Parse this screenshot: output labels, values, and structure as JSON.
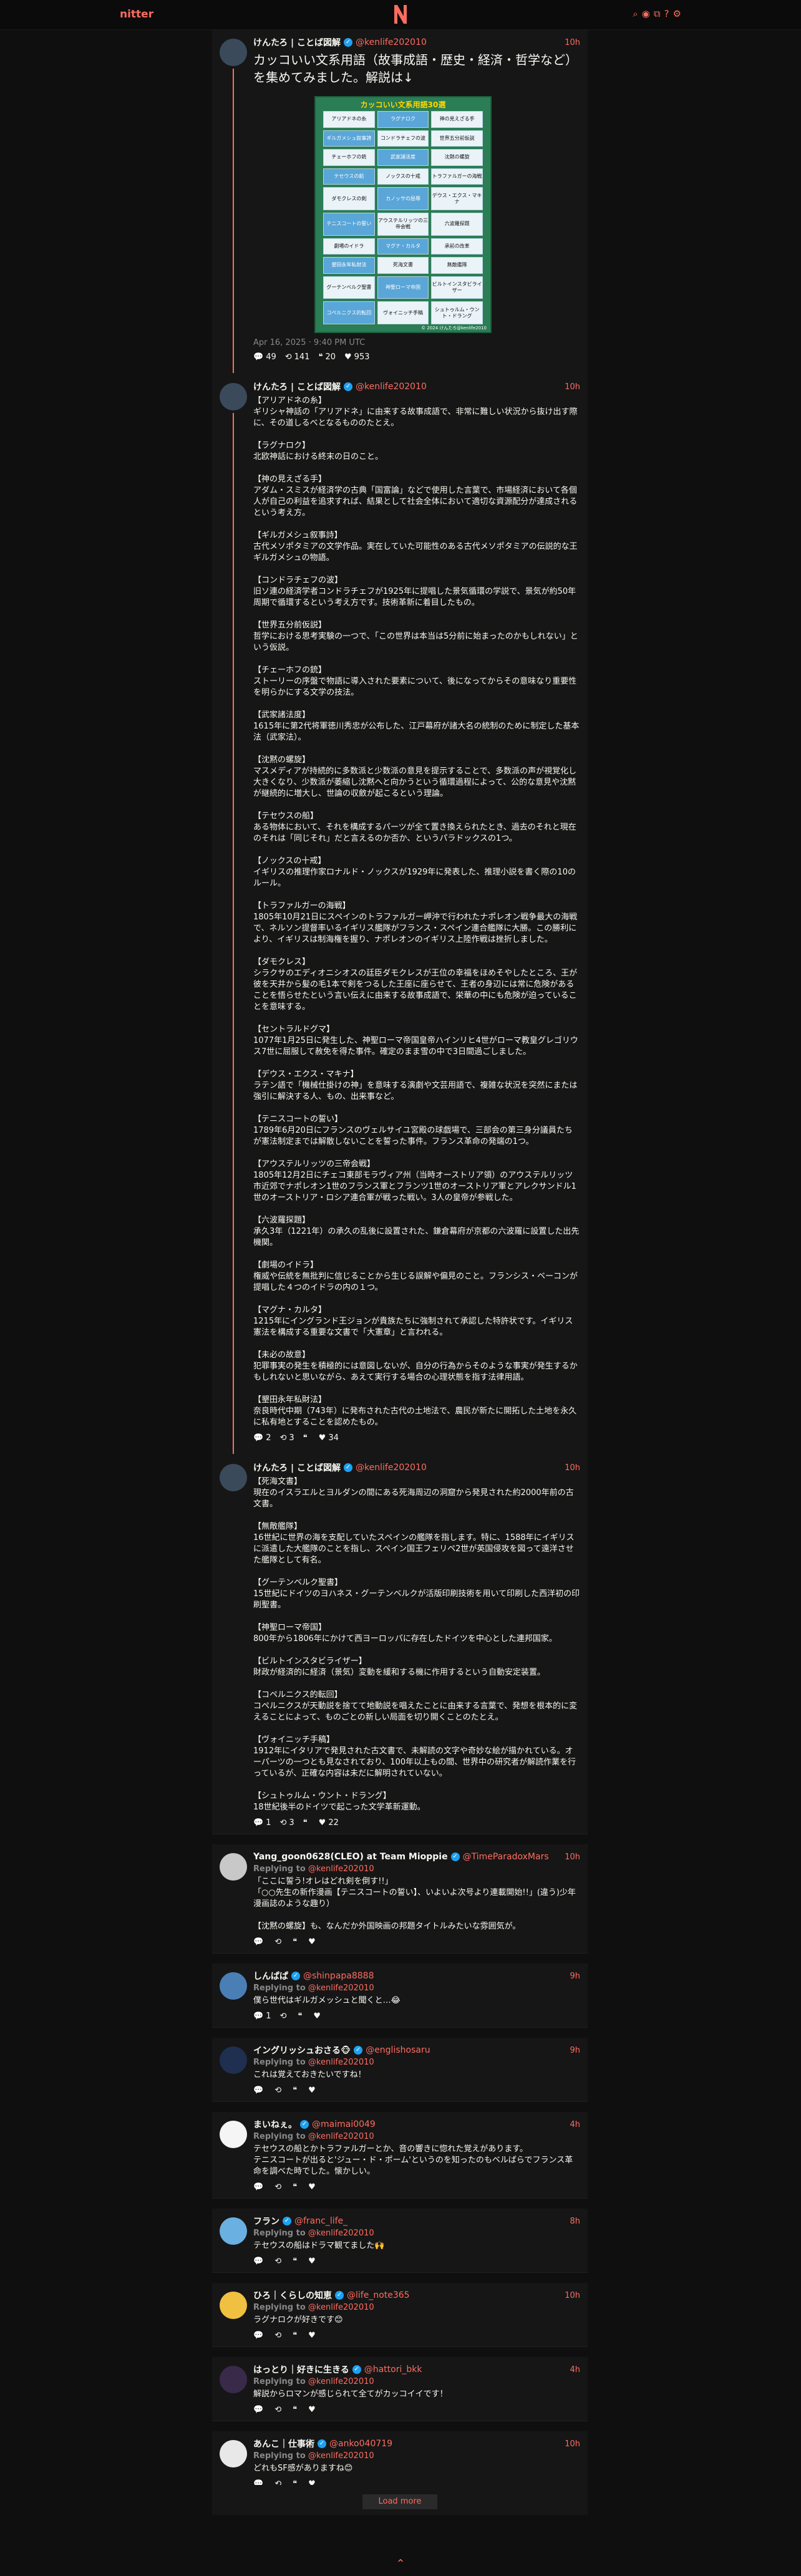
{
  "nav": {
    "brand": "nitter",
    "icons": [
      "search-icon",
      "rss-icon",
      "copy-icon",
      "info-icon",
      "settings-icon"
    ]
  },
  "main_tweet": {
    "fullname": "けんたろ | ことば図解",
    "username": "@kenlife202010",
    "date": "10h",
    "text": "カッコいい文系用語（故事成語・歴史・経済・哲学など）を集めてみました。解説は↓",
    "image": {
      "title": "カッコいい文系用語30選",
      "cells": [
        "アリアドネの糸",
        "ラグナロク",
        "神の見えざる手",
        "ギルガメシュ叙事詩",
        "コンドラチェフの波",
        "世界五分前仮説",
        "チェーホフの銃",
        "武家諸法度",
        "沈黙の螺旋",
        "テセウスの船",
        "ノックスの十戒",
        "トラファルガーの海戦",
        "ダモクレスの剣",
        "カノッサの屈辱",
        "デウス・エクス・マキナ",
        "テニスコートの誓い",
        "アウステルリッツの三帝会戦",
        "六波羅探題",
        "劇場のイドラ",
        "マグナ・カルタ",
        "承前の改革",
        "墾田永年私財法",
        "死海文書",
        "無敵艦隊",
        "グーテンベルク聖書",
        "神聖ローマ帝国",
        "ビルトインスタビライザー",
        "コペルニクス的転回",
        "ヴォイニッチ手稿",
        "シュトゥルム・ウント・ドラング"
      ],
      "credit": "© 2024 けんたろ@kenlife2010"
    },
    "timestamp": "Apr 16, 2025 · 9:40 PM UTC",
    "stats": {
      "replies": "49",
      "retweets": "141",
      "quotes": "20",
      "likes": "953"
    }
  },
  "thread_tweets": [
    {
      "fullname": "けんたろ | ことば図解",
      "username": "@kenlife202010",
      "date": "10h",
      "text": "【アリアドネの糸】\nギリシャ神話の「アリアドネ」に由来する故事成語で、非常に難しい状況から抜け出す際に、その道しるべとなるもののたとえ。\n\n【ラグナロク】\n北欧神話における終末の日のこと。\n\n【神の見えざる手】\nアダム・スミスが経済学の古典「国富論」などで使用した言葉で、市場経済において各個人が自己の利益を追求すれば、結果として社会全体において適切な資源配分が達成されるという考え方。\n\n【ギルガメシュ叙事詩】\n古代メソポタミアの文学作品。実在していた可能性のある古代メソポタミアの伝説的な王ギルガメシュの物語。\n\n【コンドラチェフの波】\n旧ソ連の経済学者コンドラチェフが1925年に提唱した景気循環の学説で、景気が約50年周期で循環するという考え方です。技術革新に着目したもの。\n\n【世界五分前仮説】\n哲学における思考実験の一つで、「この世界は本当は5分前に始まったのかもしれない」という仮説。\n\n【チェーホフの銃】\nストーリーの序盤で物語に導入された要素について、後になってからその意味なり重要性を明らかにする文学の技法。\n\n【武家諸法度】\n1615年に第2代将軍徳川秀忠が公布した、江戸幕府が諸大名の統制のために制定した基本法（武家法）。\n\n【沈黙の螺旋】\nマスメディアが持続的に多数派と少数派の意見を提示することで、多数派の声が視覚化し大きくなり、少数派が萎縮し沈黙へと向かうという循環過程によって、公的な意見や沈黙が継続的に増大し、世論の収斂が起こるという理論。\n\n【テセウスの船】\nある物体において、それを構成するパーツが全て置き換えられたとき、過去のそれと現在のそれは「同じそれ」だと言えるのか否か、というパラドックスの1つ。\n\n【ノックスの十戒】\nイギリスの推理作家ロナルド・ノックスが1929年に発表した、推理小説を書く際の10のルール。\n\n【トラファルガーの海戦】\n1805年10月21日にスペインのトラファルガー岬沖で行われたナポレオン戦争最大の海戦で、ネルソン提督率いるイギリス艦隊がフランス・スペイン連合艦隊に大勝。この勝利により、イギリスは制海権を握り、ナポレオンのイギリス上陸作戦は挫折しました。\n\n【ダモクレス】\nシラクサのエディオニシオスの廷臣ダモクレスが王位の幸福をほめそやしたところ、王が彼を天井から髪の毛1本で剣をつるした王座に座らせて、王者の身辺には常に危険があることを悟らせたという言い伝えに由来する故事成語で、栄華の中にも危険が迫っていることを意味する。\n\n【セントラルドグマ】\n1077年1月25日に発生した、神聖ローマ帝国皇帝ハインリヒ4世がローマ教皇グレゴリウス7世に屈服して赦免を得た事件。確定のまま雪の中で3日間過ごしました。\n\n【デウス・エクス・マキナ】\nラテン語で「機械仕掛けの神」を意味する演劇や文芸用語で、複雑な状況を突然にまたは強引に解決する人、もの、出来事など。\n\n【テニスコートの誓い】\n1789年6月20日にフランスのヴェルサイユ宮殿の球戯場で、三部会の第三身分議員たちが憲法制定までは解散しないことを誓った事件。フランス革命の発端の1つ。\n\n【アウステルリッツの三帝会戦】\n1805年12月2日にチェコ東部モラヴィア州（当時オーストリア領）のアウステルリッツ市近郊でナポレオン1世のフランス軍とフランツ1世のオーストリア軍とアレクサンドル1世のオーストリア・ロシア連合軍が戦った戦い。3人の皇帝が参戦した。\n\n【六波羅探題】\n承久3年（1221年）の承久の乱後に設置された、鎌倉幕府が京都の六波羅に設置した出先機関。\n\n【劇場のイドラ】\n権威や伝統を無批判に信じることから生じる誤解や偏見のこと。フランシス・ベーコンが提唱した４つのイドラの内の１つ。\n\n【マグナ・カルタ】\n1215年にイングランド王ジョンが貴族たちに強制されて承認した特許状です。イギリス憲法を構成する重要な文書で「大憲章」と言われる。\n\n【未必の故意】\n犯罪事実の発生を積極的には意図しないが、自分の行為からそのような事実が発生するかもしれないと思いながら、あえて実行する場合の心理状態を指す法律用語。\n\n【墾田永年私財法】\n奈良時代中期（743年）に発布された古代の土地法で、農民が新たに開拓した土地を永久に私有地とすることを認めたもの。",
      "stats": {
        "replies": "2",
        "retweets": "3",
        "quotes": "",
        "likes": "34"
      }
    },
    {
      "fullname": "けんたろ | ことば図解",
      "username": "@kenlife202010",
      "date": "10h",
      "text": "【死海文書】\n現在のイスラエルとヨルダンの間にある死海周辺の洞窟から発見された約2000年前の古文書。\n\n【無敵艦隊】\n16世紀に世界の海を支配していたスペインの艦隊を指します。特に、1588年にイギリスに派遣した大艦隊のことを指し、スペイン国王フェリペ2世が英国侵攻を図って遠洋させた艦隊として有名。\n\n【グーテンベルク聖書】\n15世紀にドイツのヨハネス・グーテンベルクが活版印刷技術を用いて印刷した西洋初の印刷聖書。\n\n【神聖ローマ帝国】\n800年から1806年にかけて西ヨーロッパに存在したドイツを中心とした連邦国家。\n\n【ビルトインスタビライザー】\n財政が経済的に経済（景気）変動を緩和する機に作用するという自動安定装置。\n\n【コペルニクス的転回】\nコペルニクスが天動説を捨てて地動説を唱えたことに由来する言葉で、発想を根本的に変えることによって、ものごとの新しい局面を切り開くことのたとえ。\n\n【ヴォイニッチ手稿】\n1912年にイタリアで発見された古文書で、未解読の文字や奇妙な絵が描かれている。オーパーツの一つとも見なされており、100年以上もの間、世界中の研究者が解読作業を行っているが、正確な内容は未だに解明されていない。\n\n【シュトゥルム・ウント・ドラング】\n18世紀後半のドイツで起こった文学革新運動。",
      "stats": {
        "replies": "1",
        "retweets": "3",
        "quotes": "",
        "likes": "22"
      }
    }
  ],
  "replies": [
    {
      "fullname": "Yang_goon0628(CLEO) at Team Mioppie",
      "username": "@TimeParadoxMars",
      "date": "10h",
      "replying_to": "@kenlife202010",
      "text": "「ここに誓う!オレはどれ剣を倒す!!」\n「○○先生の新作漫画【テニスコートの誓い】、いよいよ次号より連載開始!!」(違う)少年漫画誌のような趣り）\n\n【沈黙の螺旋】も、なんだか外国映画の邦題タイトルみたいな雰囲気が。",
      "stats": {
        "replies": "",
        "retweets": "",
        "quotes": "",
        "likes": ""
      }
    },
    {
      "fullname": "しんぱぱ",
      "username": "@shinpapa8888",
      "date": "9h",
      "replying_to": "@kenlife202010",
      "text": "僕ら世代はギルガメッシュと聞くと…😂",
      "stats": {
        "replies": "1",
        "retweets": "",
        "quotes": "",
        "likes": ""
      }
    },
    {
      "fullname": "イングリッシュおさる🐵",
      "username": "@englishosaru",
      "date": "9h",
      "replying_to": "@kenlife202010",
      "text": "これは覚えておきたいですね！",
      "stats": {
        "replies": "",
        "retweets": "",
        "quotes": "",
        "likes": ""
      }
    },
    {
      "fullname": "まいねぇ。",
      "username": "@maimai0049",
      "date": "4h",
      "replying_to": "@kenlife202010",
      "text": "テセウスの船とかトラファルガーとか、音の響きに惚れた覚えがあります。\nテニスコートが出ると'ジュー・ド・ポーム'というのを知ったのもベルばらでフランス革命を調べた時でした。懐かしい。",
      "stats": {
        "replies": "",
        "retweets": "",
        "quotes": "",
        "likes": ""
      }
    },
    {
      "fullname": "フラン",
      "username": "@franc_life_",
      "date": "8h",
      "replying_to": "@kenlife202010",
      "text": "テセウスの船はドラマ観てました🙌",
      "stats": {
        "replies": "",
        "retweets": "",
        "quotes": "",
        "likes": ""
      }
    },
    {
      "fullname": "ひろ｜くらしの知恵",
      "username": "@life_note365",
      "date": "10h",
      "replying_to": "@kenlife202010",
      "text": "ラグナロクが好きです😊",
      "stats": {
        "replies": "",
        "retweets": "",
        "quotes": "",
        "likes": ""
      }
    },
    {
      "fullname": "はっとり｜好きに生きる",
      "username": "@hattori_bkk",
      "date": "4h",
      "replying_to": "@kenlife202010",
      "text": "解説からロマンが感じられて全てがカッコイイです！",
      "stats": {
        "replies": "",
        "retweets": "",
        "quotes": "",
        "likes": ""
      }
    },
    {
      "fullname": "あんこ｜仕事術",
      "username": "@anko040719",
      "date": "10h",
      "replying_to": "@kenlife202010",
      "text": "どれもSF感がありますね😊",
      "stats": {
        "replies": "",
        "retweets": "",
        "quotes": "",
        "likes": ""
      }
    }
  ],
  "labels": {
    "replying_to": "Replying to",
    "load_more": "Load more",
    "verified_mark": "✓"
  },
  "colors": {
    "accent": "#ff6c60",
    "background": "#0f0f0f",
    "card": "#161616"
  }
}
